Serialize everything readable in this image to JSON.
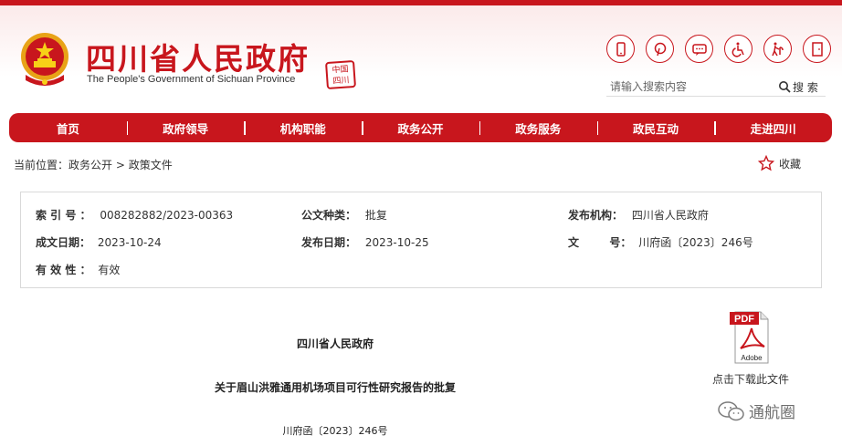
{
  "header": {
    "title": "四川省人民政府",
    "subtitle": "The People's Government of Sichuan Province",
    "seal_text": "中国四川",
    "tools": [
      "mobile-icon",
      "pinterest-icon",
      "wechat-icon",
      "accessibility-icon",
      "elder-care-icon",
      "exit-icon"
    ]
  },
  "search": {
    "placeholder": "请输入搜索内容",
    "button_label": "搜 索"
  },
  "nav": {
    "items": [
      "首页",
      "政府领导",
      "机构职能",
      "政务公开",
      "政务服务",
      "政民互动",
      "走进四川"
    ]
  },
  "breadcrumb": {
    "prefix": "当前位置：",
    "level1": "政务公开",
    "separator": ">",
    "level2": "政策文件"
  },
  "favorite": {
    "label": "收藏"
  },
  "meta": {
    "index_label": "索 引 号 ：",
    "index_value": "008282882/2023-00363",
    "type_label": "公文种类：",
    "type_value": "批复",
    "issuer_label": "发布机构：",
    "issuer_value": "四川省人民政府",
    "created_label": "成文日期：",
    "created_value": "2023-10-24",
    "published_label": "发布日期：",
    "published_value": "2023-10-25",
    "docno_label": "文        号：",
    "docno_value": "川府函〔2023〕246号",
    "validity_label": "有 效 性 ：",
    "validity_value": "有效"
  },
  "document": {
    "issuer": "四川省人民政府",
    "title": "关于眉山洪雅通用机场项目可行性研究报告的批复",
    "number": "川府函〔2023〕246号"
  },
  "pdf": {
    "badge": "PDF",
    "brand": "Adobe",
    "download_label": "点击下载此文件"
  },
  "watermark": {
    "text": "通航圈"
  },
  "colors": {
    "brand_red": "#c8161d"
  }
}
